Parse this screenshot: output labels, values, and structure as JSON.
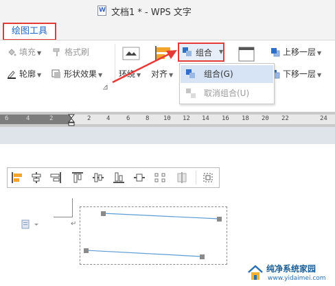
{
  "window": {
    "title": "文档1 * - WPS 文字"
  },
  "tabs": {
    "active": "绘图工具"
  },
  "ribbon": {
    "fill": "填充",
    "format_brush": "格式刷",
    "outline": "轮廓",
    "shape_effects": "形状效果",
    "wrap": "环绕",
    "align": "对齐",
    "group": "组合",
    "bring_forward": "上移一层",
    "send_backward": "下移一层"
  },
  "group_menu": {
    "items": [
      {
        "label": "组合(G)",
        "highlighted": true,
        "enabled": true
      },
      {
        "label": "取消组合(U)",
        "highlighted": false,
        "enabled": false
      }
    ]
  },
  "ruler": {
    "labels": [
      "6",
      "4",
      "2",
      "2",
      "4",
      "6",
      "8",
      "10",
      "12",
      "14",
      "16",
      "18",
      "20",
      "22",
      "24"
    ]
  },
  "align_toolbar": {
    "buttons": [
      "align-left",
      "align-center",
      "align-right",
      "align-top",
      "align-middle",
      "align-bottom",
      "distribute-horizontal",
      "distribute-vertical",
      "equal-size",
      "select-objects"
    ]
  },
  "watermark": {
    "name": "纯净系统家园",
    "url": "www.yidaimei.com"
  },
  "colors": {
    "accent_red": "#e53935",
    "tab_blue": "#1f66c4",
    "menu_highlight": "#d7e4f6"
  }
}
